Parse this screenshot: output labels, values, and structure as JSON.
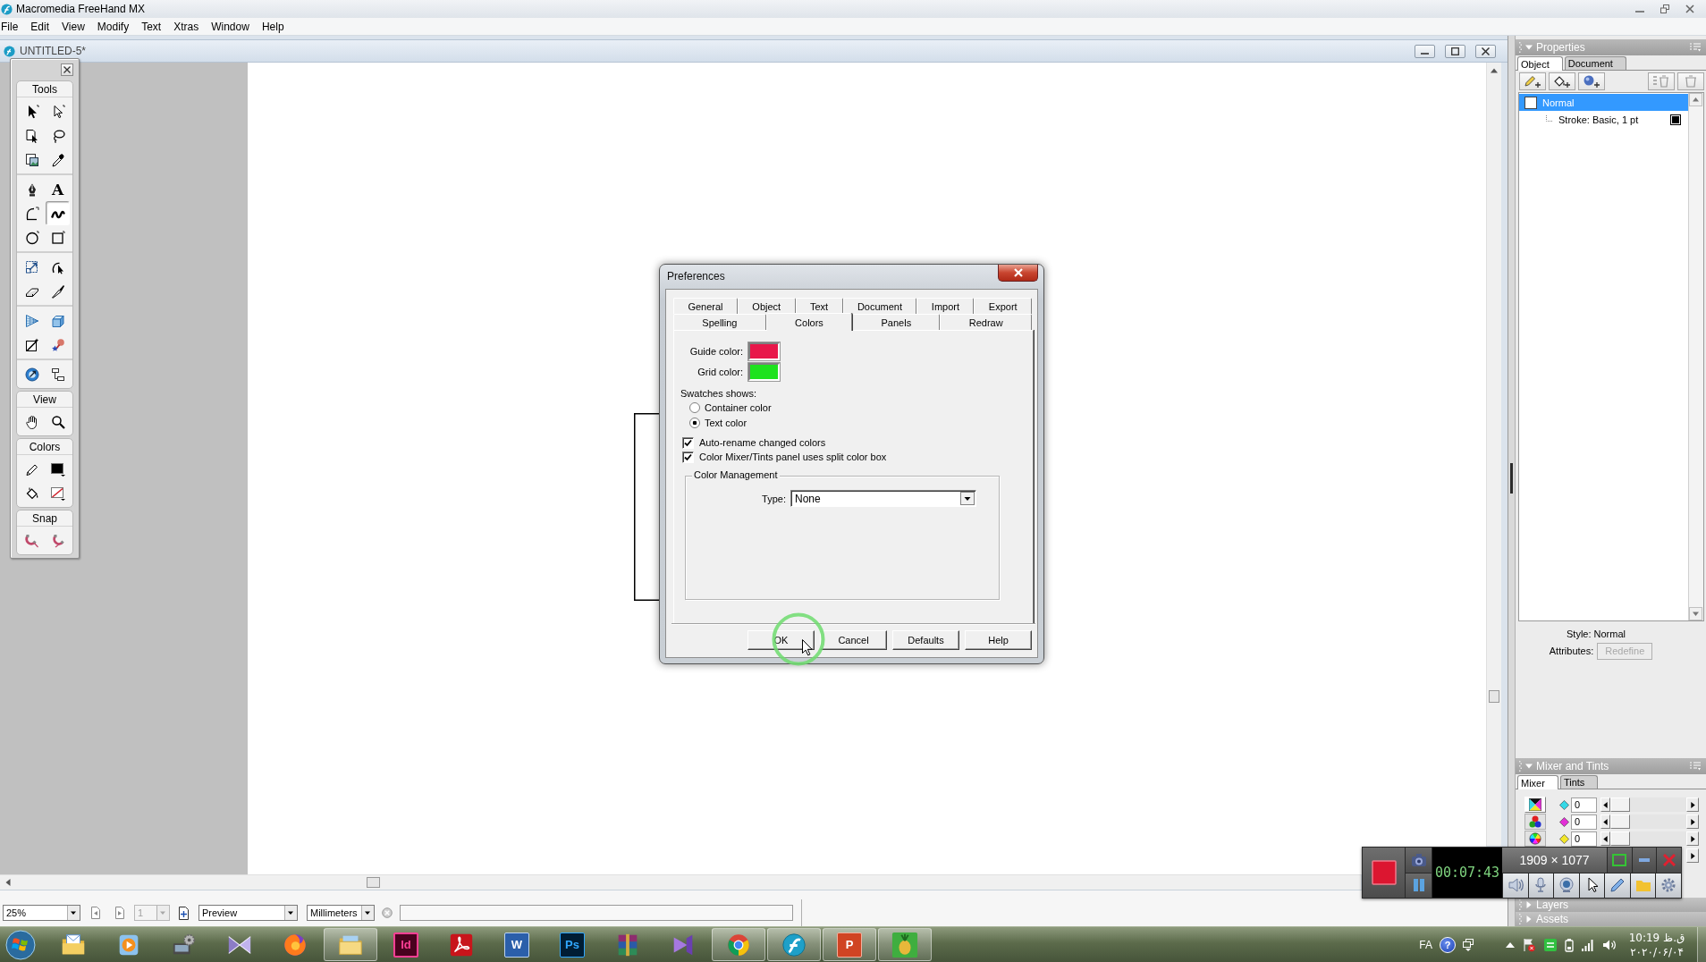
{
  "app_window": {
    "title": "Macromedia FreeHand MX"
  },
  "menu_bar": [
    "File",
    "Edit",
    "View",
    "Modify",
    "Text",
    "Xtras",
    "Window",
    "Help"
  ],
  "document_window": {
    "title": "UNTITLED-5*"
  },
  "tools_panel": {
    "sections": [
      {
        "title": "Tools",
        "groups": [
          {
            "tools": [
              {
                "selected": false
              },
              {
                "selected": false
              },
              {
                "selected": false
              },
              {
                "selected": false
              },
              {
                "selected": false
              },
              {
                "selected": false
              }
            ]
          },
          {
            "tools": [
              {
                "selected": false
              },
              {
                "glyph": "A",
                "selected": false
              },
              {
                "selected": false
              },
              {
                "selected": true
              },
              {
                "selected": false
              },
              {
                "selected": false
              }
            ]
          },
          {
            "tools": [
              {
                "selected": false
              },
              {
                "selected": false
              },
              {
                "selected": false
              },
              {
                "selected": false
              }
            ]
          },
          {
            "tools": [
              {
                "selected": false
              },
              {
                "selected": false
              },
              {
                "selected": false
              },
              {
                "selected": false
              }
            ]
          },
          {
            "tools": [
              {
                "selected": false
              },
              {
                "selected": false
              }
            ]
          }
        ]
      },
      {
        "title": "View",
        "groups": [
          {
            "tools": [
              {
                "selected": false
              },
              {
                "selected": false
              }
            ]
          }
        ]
      },
      {
        "title": "Colors",
        "groups": [
          {
            "tools": [
              {
                "selected": false
              },
              {
                "selected": false
              },
              {
                "selected": false
              },
              {
                "selected": false
              }
            ]
          }
        ]
      },
      {
        "title": "Snap",
        "groups": [
          {
            "tools": [
              {
                "selected": false
              },
              {
                "selected": false
              }
            ]
          }
        ]
      }
    ]
  },
  "dialog": {
    "title": "Preferences",
    "tab_rows": [
      {
        "tabs": [
          {
            "label": "General",
            "selected": false
          },
          {
            "label": "Object",
            "selected": false
          },
          {
            "label": "Text",
            "selected": false
          },
          {
            "label": "Document",
            "selected": false
          },
          {
            "label": "Import",
            "selected": false
          },
          {
            "label": "Export",
            "selected": false
          }
        ]
      },
      {
        "tabs": [
          {
            "label": "Spelling",
            "selected": false
          },
          {
            "label": "Colors",
            "selected": true
          },
          {
            "label": "Panels",
            "selected": false
          },
          {
            "label": "Redraw",
            "selected": false
          }
        ]
      }
    ],
    "color_settings": [
      {
        "label": "Guide color:",
        "color": "#e8174a"
      },
      {
        "label": "Grid color:",
        "color": "#1ee21e"
      }
    ],
    "swatches": {
      "label": "Swatches shows:",
      "options": [
        {
          "label": "Container color",
          "selected": false
        },
        {
          "label": "Text color",
          "selected": true
        }
      ]
    },
    "checkboxes": [
      {
        "label": "Auto-rename changed colors",
        "checked": true
      },
      {
        "label": "Color Mixer/Tints panel uses split color box",
        "checked": true
      }
    ],
    "color_management": {
      "title": "Color Management",
      "type_label": "Type:",
      "type_value": "None"
    },
    "buttons": [
      {
        "label": "OK"
      },
      {
        "label": "Cancel"
      },
      {
        "label": "Defaults"
      },
      {
        "label": "Help"
      }
    ]
  },
  "properties_panel": {
    "title": "Properties",
    "expanded": true,
    "tabs": [
      {
        "label": "Object",
        "selected": true
      },
      {
        "label": "Document",
        "selected": false
      }
    ],
    "items": [
      {
        "label": "Normal",
        "selected": true,
        "children": [
          {
            "label": "Stroke: Basic, 1 pt",
            "selected": false
          }
        ]
      }
    ],
    "style": "Style: Normal",
    "attributes_label": "Attributes:",
    "redefine_button": {
      "label": "Redefine",
      "disabled": true
    }
  },
  "mixer_panel": {
    "title": "Mixer and Tints",
    "expanded": true,
    "tabs": [
      {
        "label": "Mixer",
        "selected": true
      },
      {
        "label": "Tints",
        "selected": false
      }
    ],
    "modes": [
      {
        "selected": true
      },
      {
        "selected": false
      },
      {
        "selected": false
      }
    ],
    "channels": [
      {
        "color": "#35d8e6",
        "value": "0",
        "level": 0
      },
      {
        "color": "#e22fd6",
        "value": "0",
        "level": 0
      },
      {
        "color": "#f2e62a",
        "value": "0",
        "level": 0
      }
    ]
  },
  "collapsed_panels": [
    {
      "title": "Layers",
      "expanded": false
    },
    {
      "title": "Assets",
      "expanded": false
    }
  ],
  "status_bar": {
    "zoom": "25%",
    "page": {
      "value": "1",
      "disabled": true
    },
    "view_mode": "Preview",
    "units": "Millimeters"
  },
  "recorder": {
    "time": "00:07:43",
    "resolution": "1909 × 1077"
  },
  "taskbar": {
    "apps": [
      {
        "running": false
      },
      {
        "running": false
      },
      {
        "running": false
      },
      {
        "running": false
      },
      {
        "running": false
      },
      {
        "running": true
      },
      {
        "glyph": "Id",
        "running": false
      },
      {
        "running": false
      },
      {
        "glyph": "W",
        "running": false
      },
      {
        "glyph": "Ps",
        "running": false
      },
      {
        "running": false
      },
      {
        "running": false
      },
      {
        "running": true
      },
      {
        "running": true
      },
      {
        "glyph": "P",
        "running": true
      },
      {
        "running": true
      }
    ],
    "tray": {
      "language": "FA",
      "help": "?",
      "time": "10:19 ق.ظ",
      "date": "۲۰۲۰/۰۶/۰۴"
    }
  }
}
